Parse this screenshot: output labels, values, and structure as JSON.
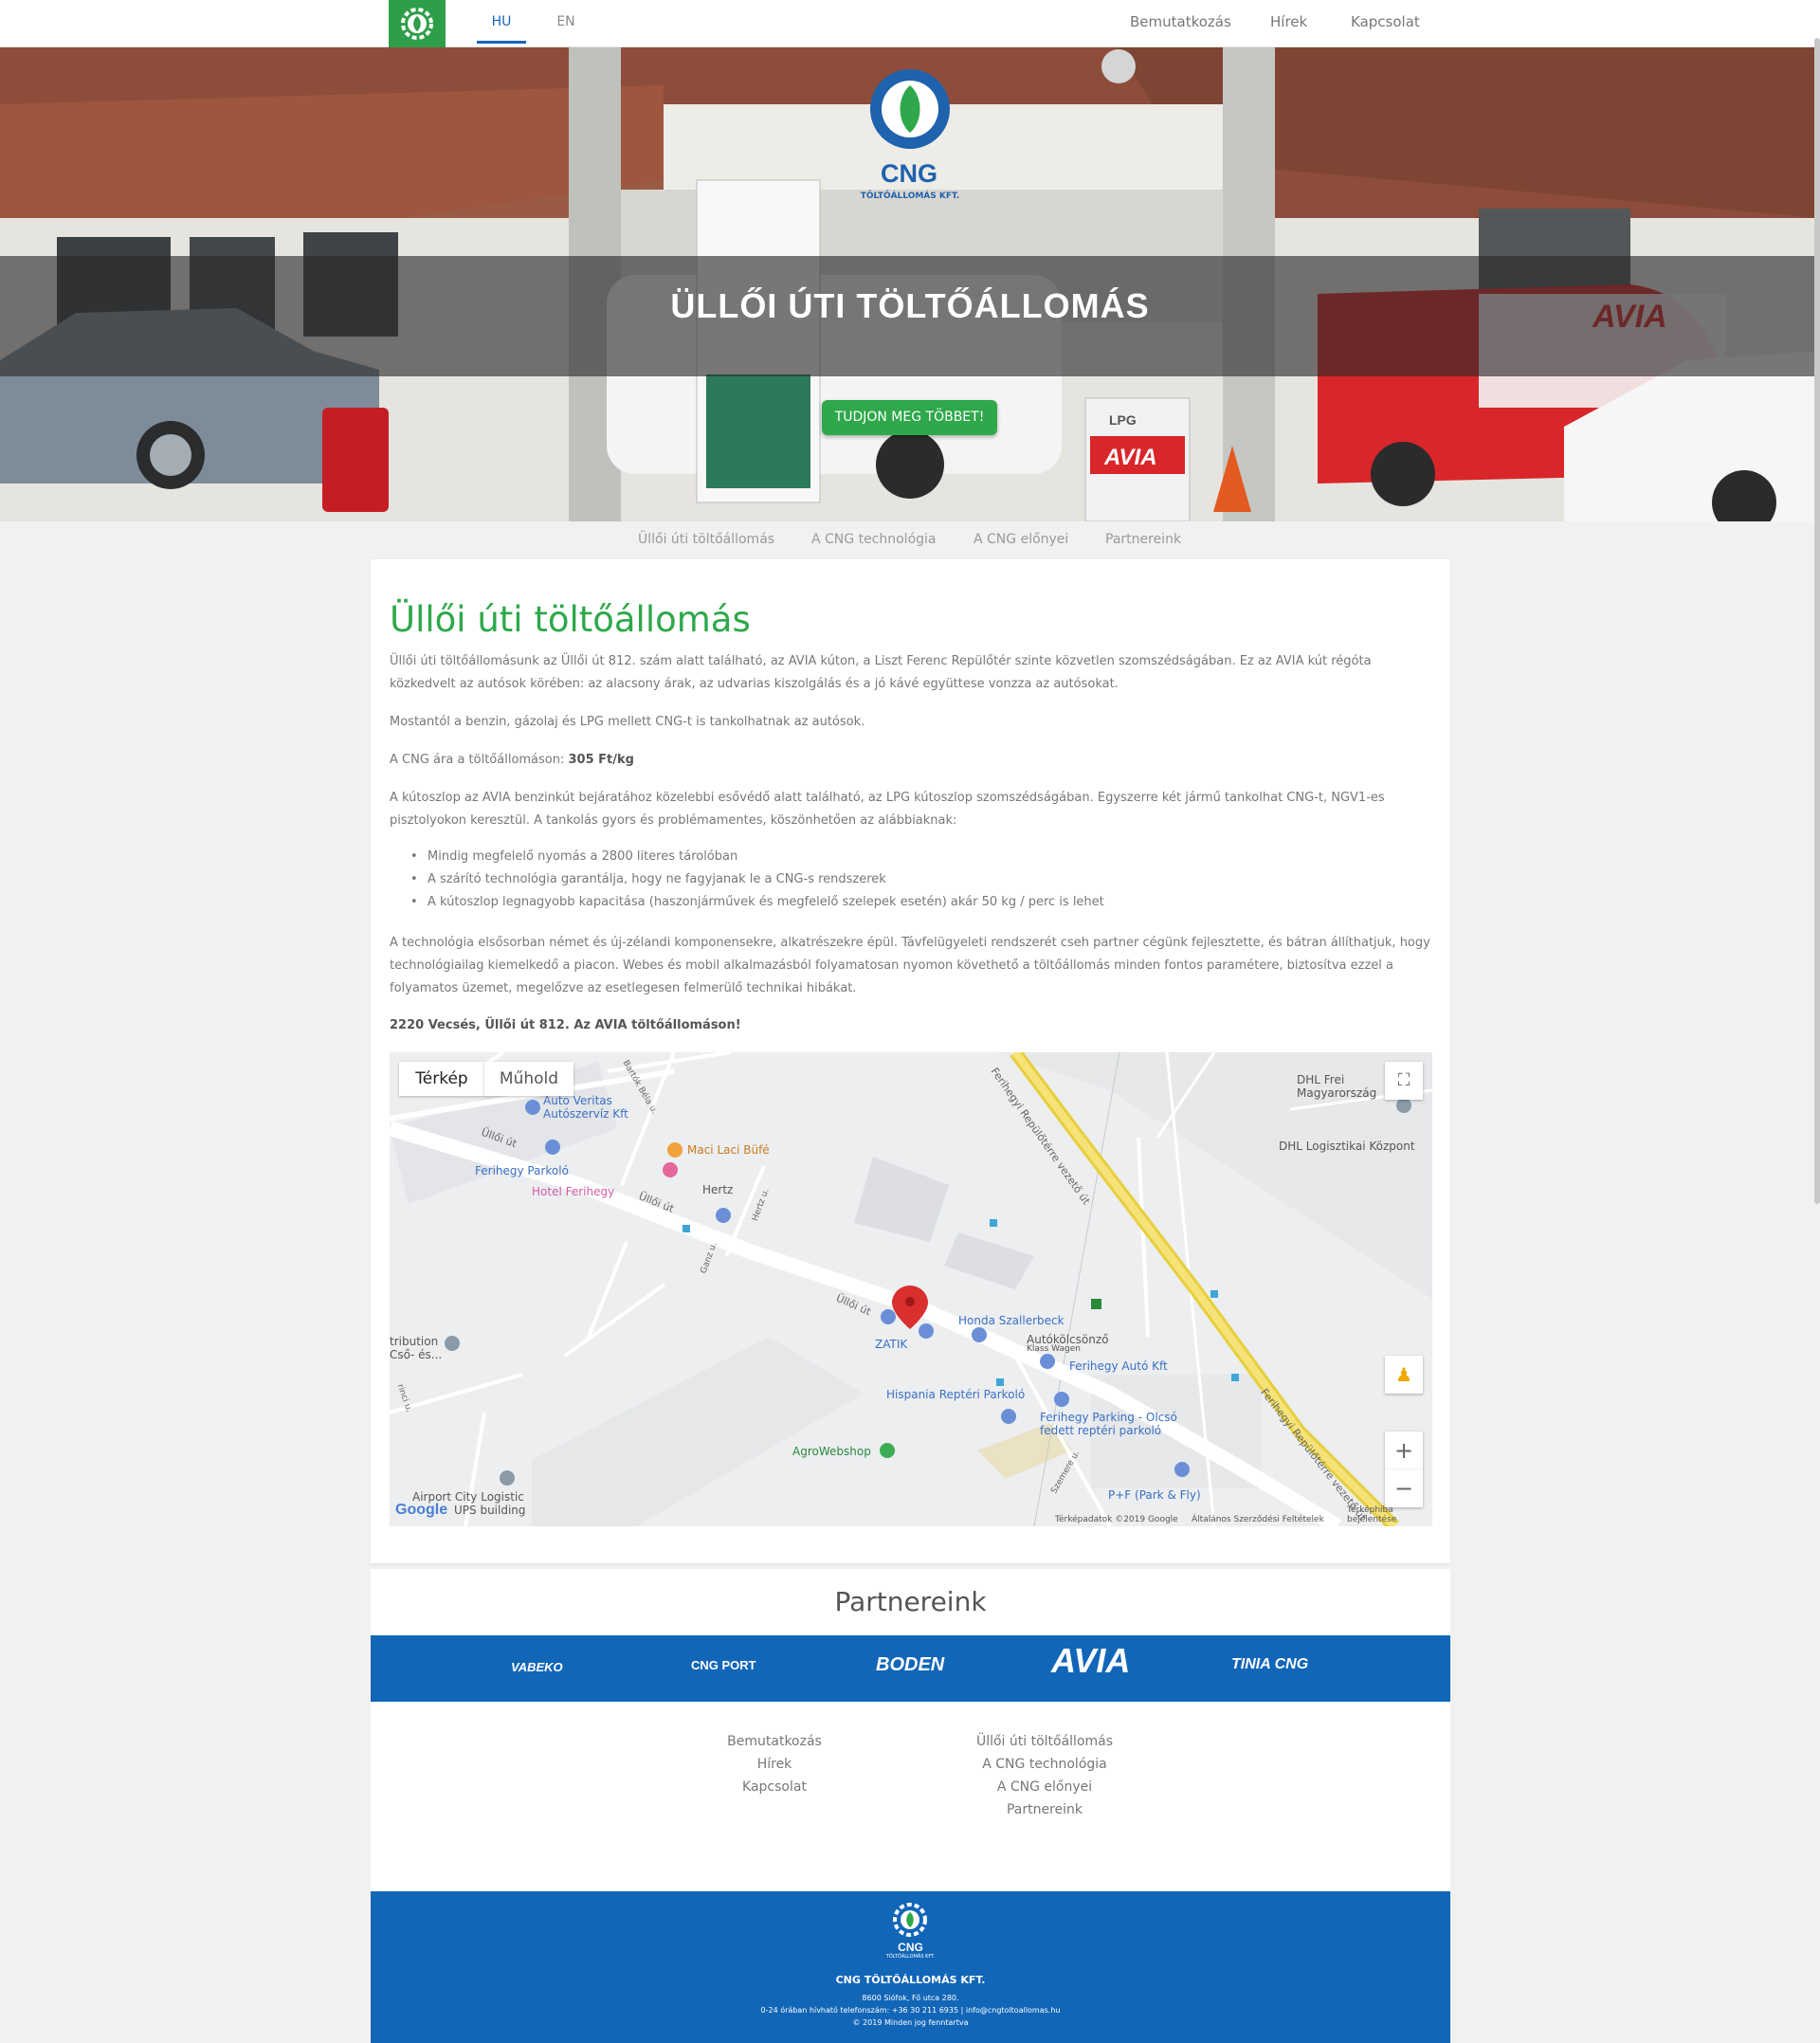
{
  "nav": {
    "languages": [
      "HU",
      "EN"
    ],
    "links": [
      "Bemutatkozás",
      "Hírek",
      "Kapcsolat"
    ]
  },
  "hero": {
    "logo_text": "CNG",
    "logo_sub": "TÖLTŐÁLLOMÁS KFT.",
    "title": "ÜLLŐI ÚTI TÖLTŐÁLLOMÁS",
    "button": "TUDJON MEG TÖBBET!"
  },
  "subnav": [
    "Üllői úti töltőállomás",
    "A CNG technológia",
    "A CNG előnyei",
    "Partnereink"
  ],
  "article": {
    "title": "Üllői úti töltőállomás",
    "p1": "Üllői úti töltőállomásunk az Üllői út 812. szám alatt található, az AVIA kúton, a Liszt Ferenc Repülőtér szinte közvetlen szomszédságában. Ez az AVIA kút régóta közkedvelt az autósok körében: az alacsony árak, az udvarias kiszolgálás és a jó kávé együttese vonzza az autósokat.",
    "p2": "Mostantól a benzin, gázolaj és LPG mellett CNG-t is tankolhatnak az autósok.",
    "p3_prefix": "A CNG ára a töltőállomáson: ",
    "p3_price": "305 Ft/kg",
    "p4": "A kútoszlop az AVIA benzinkút bejáratához közelebbi esővédő alatt található, az LPG kútoszlop szomszédságában. Egyszerre két jármű tankolhat CNG-t, NGV1-es pisztolyokon keresztül. A tankolás gyors és problémamentes, köszönhetően az alábbiaknak:",
    "bullets": [
      "Mindig megfelelő nyomás a 2800 literes tárolóban",
      "A szárító technológia garantálja, hogy ne fagyjanak le a CNG-s rendszerek",
      "A kútoszlop legnagyobb kapacitása (haszonjárművek és megfelelő szelepek esetén) akár 50 kg / perc is lehet"
    ],
    "p5": "A technológia elsősorban német és új-zélandi komponensekre, alkatrészekre épül. Távfelügyeleti rendszerét cseh partner cégünk fejlesztette, és bátran állíthatjuk, hogy technológiailag kiemelkedő a piacon. Webes és mobil alkalmazásból folyamatosan nyomon követhető a töltőállomás minden fontos paramétere, biztosítva ezzel a folyamatos üzemet, megelőzve az esetlegesen felmerülő technikai hibákat.",
    "address": "2220 Vecsés, Üllői út 812. Az AVIA töltőállomáson!"
  },
  "map": {
    "tab_map": "Térkép",
    "tab_sat": "Műhold",
    "labels": {
      "auto_veritas": "Auto Veritas",
      "autoszerviz": "Autószervíz Kft",
      "maci": "Maci Laci Büfé",
      "ferihegy_parkolo": "Ferihegy Parkoló",
      "hotel": "Hotel Ferihegy",
      "hertz": "Hertz",
      "zatik": "ZATIK",
      "honda": "Honda Szallerbeck",
      "autokolcsonzo": "Autókölcsönző",
      "klass": "Klass Wagen",
      "ferihegy_auto": "Ferihegy Autó Kft",
      "hispania": "Hispania Reptéri Parkoló",
      "ferihegy_parking": "Ferihegy Parking - Olcsó",
      "fedett": "fedett reptéri parkoló",
      "agro": "AgroWebshop",
      "pf": "P+F (Park & Fly)",
      "airport_city": "Airport City Logistic",
      "ups": "UPS building",
      "distribution": "tribution",
      "cso": "Cső- és...",
      "dhl_frei": "DHL Frei",
      "magyarorszag": "Magyarország",
      "dhl_log": "DHL Logisztikai Központ",
      "ulloi1": "Üllői út",
      "ulloi2": "Üllői út",
      "ulloi3": "Üllői út",
      "road1": "Ferihegyi Repülőtérre vezető út",
      "road2": "Ferihegyi Repülőtérre vezető út",
      "bartok": "Bartók Béla u.",
      "hertz_u": "Hertz u.",
      "ganz": "Ganz u.",
      "szemere": "Szemere u.",
      "rinci": "rinci u."
    },
    "footer_data": "Térképadatok ©2019 Google",
    "footer_terms": "Általános Szerződési Feltételek",
    "footer_report": "Térképhiba bejelentése",
    "google": "Google"
  },
  "partners": {
    "title": "Partnereink",
    "logos": [
      "VABEKO",
      "CNG PORT",
      "BODEN",
      "AVIA",
      "TINIA CNG"
    ]
  },
  "footer_links": {
    "col1": [
      "Bemutatkozás",
      "Hírek",
      "Kapcsolat"
    ],
    "col2": [
      "Üllői úti töltőállomás",
      "A CNG technológia",
      "A CNG előnyei",
      "Partnereink"
    ]
  },
  "footer": {
    "logo_text": "CNG",
    "logo_sub": "TÖLTŐÁLLOMÁS KFT.",
    "company": "CNG TÖLTŐÁLLOMÁS KFT.",
    "address": "8600 Siófok, Fő utca 280.",
    "contact": "0-24 órában hívható telefonszám: +36 30 211 6935 | info@cngtoltoallomas.hu",
    "copyright": "© 2019 Minden jog fenntartva"
  },
  "colors": {
    "brand_green": "#2ea84a",
    "brand_blue": "#1266b8"
  }
}
